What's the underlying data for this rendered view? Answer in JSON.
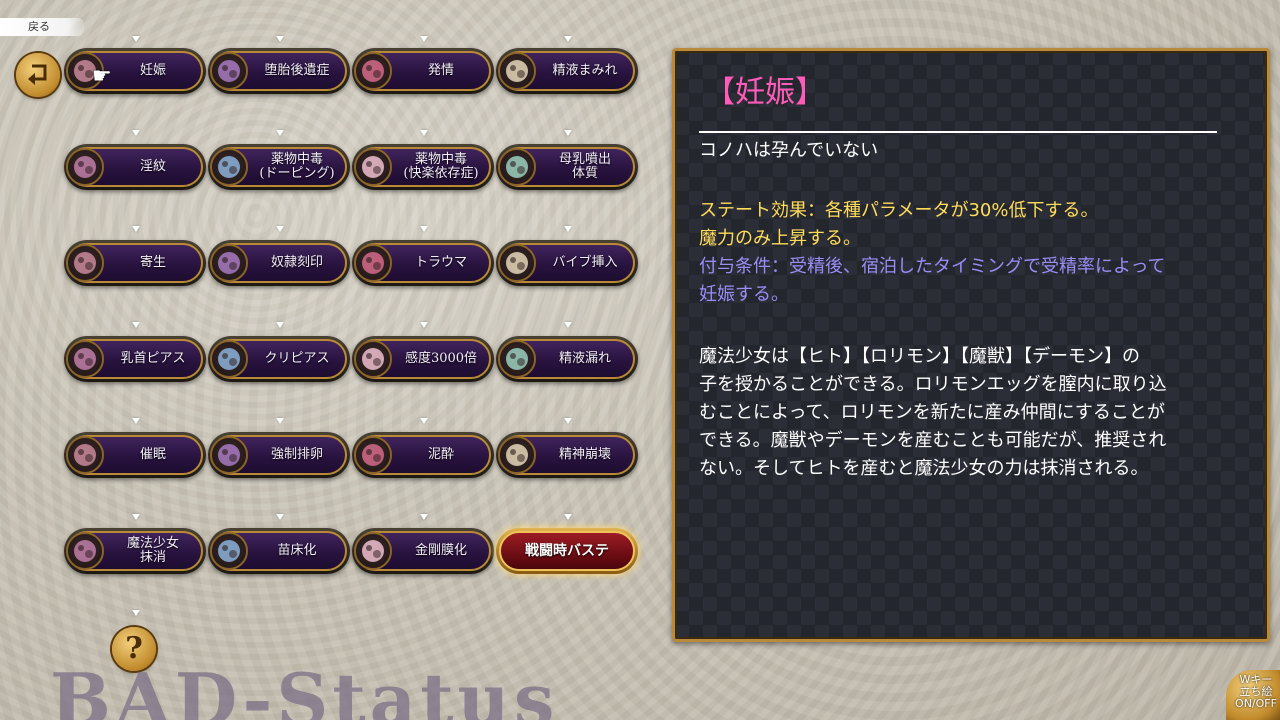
{
  "back": {
    "label": "戻る"
  },
  "grid": [
    [
      {
        "label": "妊娠",
        "icon": "pregnancy-icon"
      },
      {
        "label": "堕胎後遺症",
        "icon": "aftereffect-icon"
      },
      {
        "label": "発情",
        "icon": "heat-icon"
      },
      {
        "label": "精液まみれ",
        "icon": "semen-covered-icon"
      }
    ],
    [
      {
        "label": "淫紋",
        "icon": "lewd-crest-icon"
      },
      {
        "label": "薬物中毒\n(ドーピング)",
        "icon": "drug-doping-icon"
      },
      {
        "label": "薬物中毒\n(快楽依存症)",
        "icon": "drug-pleasure-icon"
      },
      {
        "label": "母乳噴出\n体質",
        "icon": "breast-milk-icon"
      }
    ],
    [
      {
        "label": "寄生",
        "icon": "parasite-icon"
      },
      {
        "label": "奴隷刻印",
        "icon": "slave-mark-icon"
      },
      {
        "label": "トラウマ",
        "icon": "trauma-icon"
      },
      {
        "label": "バイブ挿入",
        "icon": "vibrator-icon"
      }
    ],
    [
      {
        "label": "乳首ピアス",
        "icon": "nipple-piercing-icon"
      },
      {
        "label": "クリピアス",
        "icon": "clit-piercing-icon"
      },
      {
        "label": "感度3000倍",
        "icon": "sensitivity-icon"
      },
      {
        "label": "精液漏れ",
        "icon": "semen-leak-icon"
      }
    ],
    [
      {
        "label": "催眠",
        "icon": "hypnosis-icon"
      },
      {
        "label": "強制排卵",
        "icon": "ovulation-icon"
      },
      {
        "label": "泥酔",
        "icon": "drunk-icon"
      },
      {
        "label": "精神崩壊",
        "icon": "mental-break-icon"
      }
    ],
    [
      {
        "label": "魔法少女\n抹消",
        "icon": "magical-girl-erased-icon"
      },
      {
        "label": "苗床化",
        "icon": "seedbed-icon"
      },
      {
        "label": "金剛膜化",
        "icon": "diamond-membrane-icon"
      },
      {
        "label": "戦闘時バステ",
        "icon": "",
        "active": true
      }
    ]
  ],
  "title_watermark": "BAD-Status",
  "detail": {
    "title": "【妊娠】",
    "description": "コノハは孕んでいない",
    "effect_line1": "ステート効果：各種パラメータが30%低下する。",
    "effect_line2": "魔力のみ上昇する。",
    "condition_line1": "付与条件：受精後、宿泊したタイミングで受精率によって",
    "condition_line2": "妊娠する。",
    "body_line1": "魔法少女は【ヒト】【ロリモン】【魔獣】【デーモン】の",
    "body_line2": "子を授かることができる。ロリモンエッグを膣内に取り込",
    "body_line3": "むことによって、ロリモンを新たに産み仲間にすることが",
    "body_line4": "できる。魔獣やデーモンを産むことも可能だが、推奨され",
    "body_line5": "ない。そしてヒトを産むと魔法少女の力は抹消される。"
  },
  "standee_toggle": {
    "label": "Wキー\n立ち絵\nON/OFF"
  }
}
